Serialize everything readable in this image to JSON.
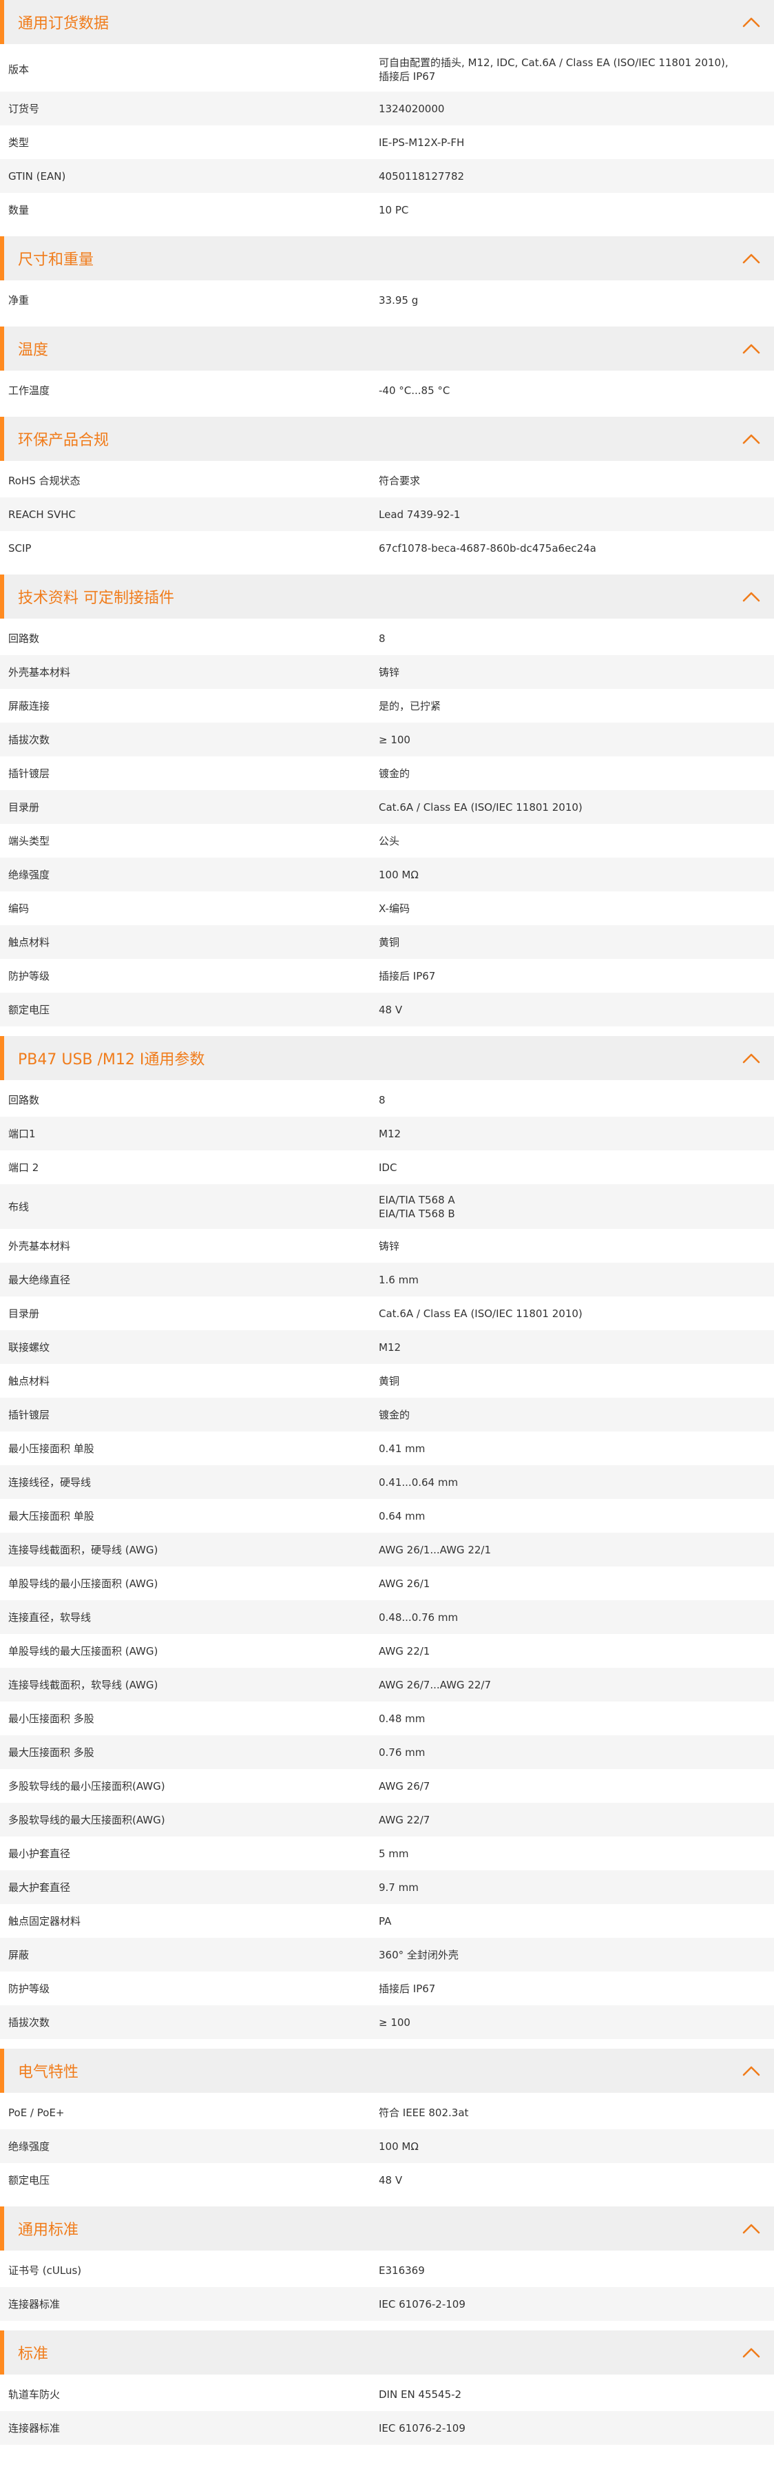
{
  "accent_color": "#f07c1b",
  "collapse_icon": "chevron-up-icon",
  "sections": [
    {
      "title": "通用订货数据",
      "rows": [
        {
          "label": "版本",
          "value": "可自由配置的插头, M12, IDC, Cat.6A / Class EA (ISO/IEC 11801 2010),\n插接后 IP67"
        },
        {
          "label": "订货号",
          "value": "1324020000"
        },
        {
          "label": "类型",
          "value": "IE-PS-M12X-P-FH"
        },
        {
          "label": "GTIN (EAN)",
          "value": "4050118127782"
        },
        {
          "label": "数量",
          "value": "10  PC"
        }
      ]
    },
    {
      "title": "尺寸和重量",
      "rows": [
        {
          "label": "净重",
          "value": "33.95  g"
        }
      ]
    },
    {
      "title": "温度",
      "rows": [
        {
          "label": "工作温度",
          "value": "-40 °C...85 °C"
        }
      ]
    },
    {
      "title": "环保产品合规",
      "rows": [
        {
          "label": "RoHS 合规状态",
          "value": "符合要求"
        },
        {
          "label": "REACH SVHC",
          "value": "Lead 7439-92-1"
        },
        {
          "label": "SCIP",
          "value": "67cf1078-beca-4687-860b-dc475a6ec24a"
        }
      ]
    },
    {
      "title": "技术资料 可定制接插件",
      "rows": [
        {
          "label": "回路数",
          "value": "8"
        },
        {
          "label": "外壳基本材料",
          "value": "铸锌"
        },
        {
          "label": "屏蔽连接",
          "value": "是的，已拧紧"
        },
        {
          "label": "插拔次数",
          "value": "≥ 100"
        },
        {
          "label": "插针镀层",
          "value": "镀金的"
        },
        {
          "label": "目录册",
          "value": "Cat.6A / Class EA (ISO/IEC 11801 2010)"
        },
        {
          "label": "端头类型",
          "value": "公头"
        },
        {
          "label": "绝缘强度",
          "value": "100 MΩ"
        },
        {
          "label": "编码",
          "value": "X-编码"
        },
        {
          "label": "触点材料",
          "value": "黄铜"
        },
        {
          "label": "防护等级",
          "value": "插接后 IP67"
        },
        {
          "label": "额定电压",
          "value": "48  V"
        }
      ]
    },
    {
      "title": "PB47 USB /M12 I通用参数",
      "rows": [
        {
          "label": "回路数",
          "value": "8"
        },
        {
          "label": "端口1",
          "value": "M12"
        },
        {
          "label": "端口 2",
          "value": "IDC"
        },
        {
          "label": "布线",
          "value": "EIA/TIA T568 A\nEIA/TIA T568 B"
        },
        {
          "label": "外壳基本材料",
          "value": "铸锌"
        },
        {
          "label": "最大绝缘直径",
          "value": "1.6  mm"
        },
        {
          "label": "目录册",
          "value": "Cat.6A / Class EA (ISO/IEC 11801 2010)"
        },
        {
          "label": "联接螺纹",
          "value": "M12"
        },
        {
          "label": "触点材料",
          "value": "黄铜"
        },
        {
          "label": "插针镀层",
          "value": "镀金的"
        },
        {
          "label": "最小压接面积 单股",
          "value": "0.41  mm"
        },
        {
          "label": "连接线径，硬导线",
          "value": "0.41...0.64 mm"
        },
        {
          "label": "最大压接面积 单股",
          "value": "0.64  mm"
        },
        {
          "label": "连接导线截面积，硬导线 (AWG)",
          "value": "AWG 26/1...AWG 22/1"
        },
        {
          "label": "单股导线的最小压接面积 (AWG)",
          "value": "AWG 26/1"
        },
        {
          "label": "连接直径，软导线",
          "value": "0.48...0.76 mm"
        },
        {
          "label": "单股导线的最大压接面积 (AWG)",
          "value": "AWG 22/1"
        },
        {
          "label": "连接导线截面积，软导线 (AWG)",
          "value": "AWG 26/7...AWG 22/7"
        },
        {
          "label": "最小压接面积 多股",
          "value": "0.48  mm"
        },
        {
          "label": "最大压接面积 多股",
          "value": "0.76  mm"
        },
        {
          "label": "多股软导线的最小压接面积(AWG)",
          "value": "AWG 26/7"
        },
        {
          "label": "多股软导线的最大压接面积(AWG)",
          "value": "AWG 22/7"
        },
        {
          "label": "最小护套直径",
          "value": "5  mm"
        },
        {
          "label": "最大护套直径",
          "value": "9.7  mm"
        },
        {
          "label": "触点固定器材料",
          "value": "PA"
        },
        {
          "label": "屏蔽",
          "value": "360° 全封闭外壳"
        },
        {
          "label": "防护等级",
          "value": "插接后 IP67"
        },
        {
          "label": "插拔次数",
          "value": "≥ 100"
        }
      ]
    },
    {
      "title": "电气特性",
      "rows": [
        {
          "label": "PoE / PoE+",
          "value": "符合 IEEE 802.3at"
        },
        {
          "label": "绝缘强度",
          "value": "100 MΩ"
        },
        {
          "label": "额定电压",
          "value": "48  V"
        }
      ]
    },
    {
      "title": "通用标准",
      "rows": [
        {
          "label": "证书号 (cULus)",
          "value": "E316369"
        },
        {
          "label": "连接器标准",
          "value": "IEC 61076-2-109"
        }
      ]
    },
    {
      "title": "标准",
      "rows": [
        {
          "label": "轨道车防火",
          "value": "DIN EN 45545-2"
        },
        {
          "label": "连接器标准",
          "value": "IEC 61076-2-109"
        }
      ]
    }
  ]
}
